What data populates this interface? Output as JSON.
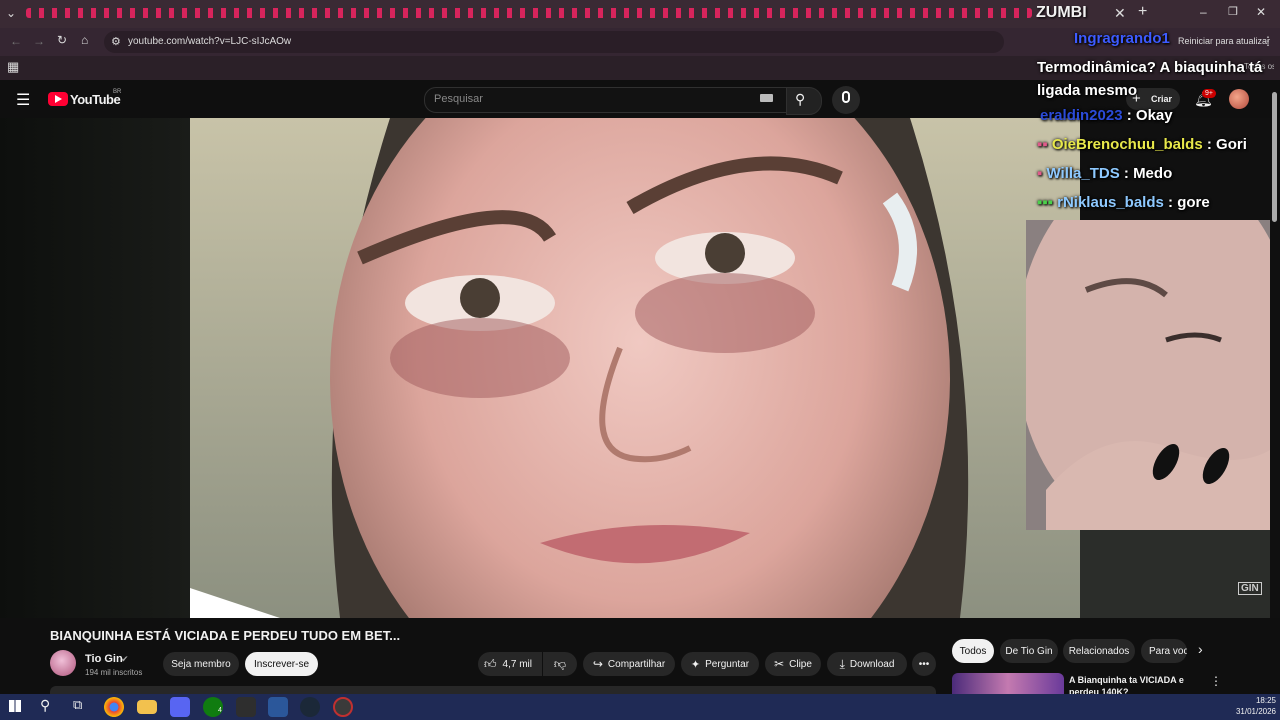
{
  "browser": {
    "url": "youtube.com/watch?v=LJC-sIJcAOw",
    "update_button": "Reiniciar para atualizar",
    "bookmarks_label": "Todos os favoritos"
  },
  "youtube": {
    "logo": "YouTube",
    "region": "BR",
    "search_placeholder": "Pesquisar",
    "create_label": "Criar",
    "notif_badge": "9+"
  },
  "stream": {
    "title": "ZUMBI",
    "chat": [
      {
        "user": "Ingragrando1",
        "text": "Termodinâmica? A biaquinha tá ligada mesmo",
        "color": "#3d5bff"
      },
      {
        "user": "eraldin2023",
        "text": "Okay",
        "color": "#2b4bd8"
      },
      {
        "user": "OieBrenochuu_balds",
        "text": "Gori",
        "color": "#e8e84a"
      },
      {
        "user": "Willa_TDS",
        "text": "Medo",
        "color": "#8ec9ff"
      },
      {
        "user": "rNiklaus_balds",
        "text": "gore",
        "color": "#8ec9ff"
      }
    ],
    "watermark": "GIN"
  },
  "video": {
    "title": "BIANQUINHA ESTÁ VICIADA E PERDEU TUDO EM BET...",
    "channel": "Tio Gin",
    "subscribers": "194 mil inscritos",
    "member_label": "Seja membro",
    "subscribe_label": "Inscrever-se",
    "likes": "4,7 mil",
    "share_label": "Compartilhar",
    "ask_label": "Perguntar",
    "clip_label": "Clipe",
    "download_label": "Download"
  },
  "chips": [
    "Todos",
    "De Tio Gin",
    "Relacionados",
    "Para você"
  ],
  "recommended": {
    "title": "A Bianquinha ta VICIADA e perdeu 140K?"
  },
  "taskbar": {
    "time": "18:25",
    "date": "31/01/2026",
    "xbox_badge": "4"
  },
  "colors": {
    "accent": "#ff0033",
    "chrome": "#352632",
    "taskbar": "#1f2a55"
  }
}
